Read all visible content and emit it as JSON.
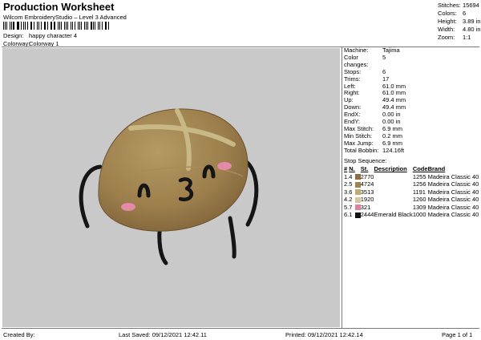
{
  "header": {
    "title": "Production Worksheet",
    "subtitle": "Wilcom EmbroideryStudio – Level 3 Advanced",
    "design_label": "Design:",
    "design_value": "happy character 4",
    "colorway_label": "Colorway:",
    "colorway_value": "Colorway 1"
  },
  "summary": [
    {
      "label": "Stitches:",
      "value": "15694"
    },
    {
      "label": "Colors:",
      "value": "6"
    },
    {
      "label": "Height:",
      "value": "3.89 in"
    },
    {
      "label": "Width:",
      "value": "4.80 in"
    },
    {
      "label": "Zoom:",
      "value": "1:1"
    }
  ],
  "machine_info": [
    {
      "label": "Machine:",
      "value": "Tajima"
    },
    {
      "label": "Color changes:",
      "value": "5"
    },
    {
      "label": "Stops:",
      "value": "6"
    },
    {
      "label": "Trims:",
      "value": "17"
    },
    {
      "label": "Left:",
      "value": "61.0 mm"
    },
    {
      "label": "Right:",
      "value": "61.0 mm"
    },
    {
      "label": "Up:",
      "value": "49.4 mm"
    },
    {
      "label": "Down:",
      "value": "49.4 mm"
    },
    {
      "label": "EndX:",
      "value": "0.00 in"
    },
    {
      "label": "EndY:",
      "value": "0.00 in"
    },
    {
      "label": "Max Stitch:",
      "value": "6.9 mm"
    },
    {
      "label": "Min Stitch:",
      "value": "0.2 mm"
    },
    {
      "label": "Max Jump:",
      "value": "6.9 mm"
    },
    {
      "label": "Total Bobbin:",
      "value": "124.16ft"
    }
  ],
  "stop_sequence": {
    "title": "Stop Sequence:",
    "headers": [
      "#",
      "N.",
      "St.",
      "Description",
      "Code",
      "Brand"
    ],
    "rows": [
      {
        "stop": "1.",
        "needle": "4",
        "color": "#8e6a45",
        "stitches": "2770",
        "description": "",
        "code": "1255",
        "brand": "Madeira Classic 40"
      },
      {
        "stop": "2.",
        "needle": "5",
        "color": "#a0814f",
        "stitches": "4724",
        "description": "",
        "code": "1256",
        "brand": "Madeira Classic 40"
      },
      {
        "stop": "3.",
        "needle": "6",
        "color": "#c2ab73",
        "stitches": "3513",
        "description": "",
        "code": "1191",
        "brand": "Madeira Classic 40"
      },
      {
        "stop": "4.",
        "needle": "2",
        "color": "#d6c79a",
        "stitches": "1920",
        "description": "",
        "code": "1260",
        "brand": "Madeira Classic 40"
      },
      {
        "stop": "5.",
        "needle": "7",
        "color": "#e07fa2",
        "stitches": "321",
        "description": "",
        "code": "1309",
        "brand": "Madeira Classic 40"
      },
      {
        "stop": "6.",
        "needle": "1",
        "color": "#111111",
        "stitches": "2444",
        "description": "Emerald Black",
        "code": "1000",
        "brand": "Madeira Classic 40"
      }
    ]
  },
  "footer": {
    "created_by": "Created By:",
    "last_saved": "Last Saved: 09/12/2021 12:42.11",
    "printed": "Printed: 09/12/2021 12:42.14",
    "page": "Page 1 of 1"
  }
}
